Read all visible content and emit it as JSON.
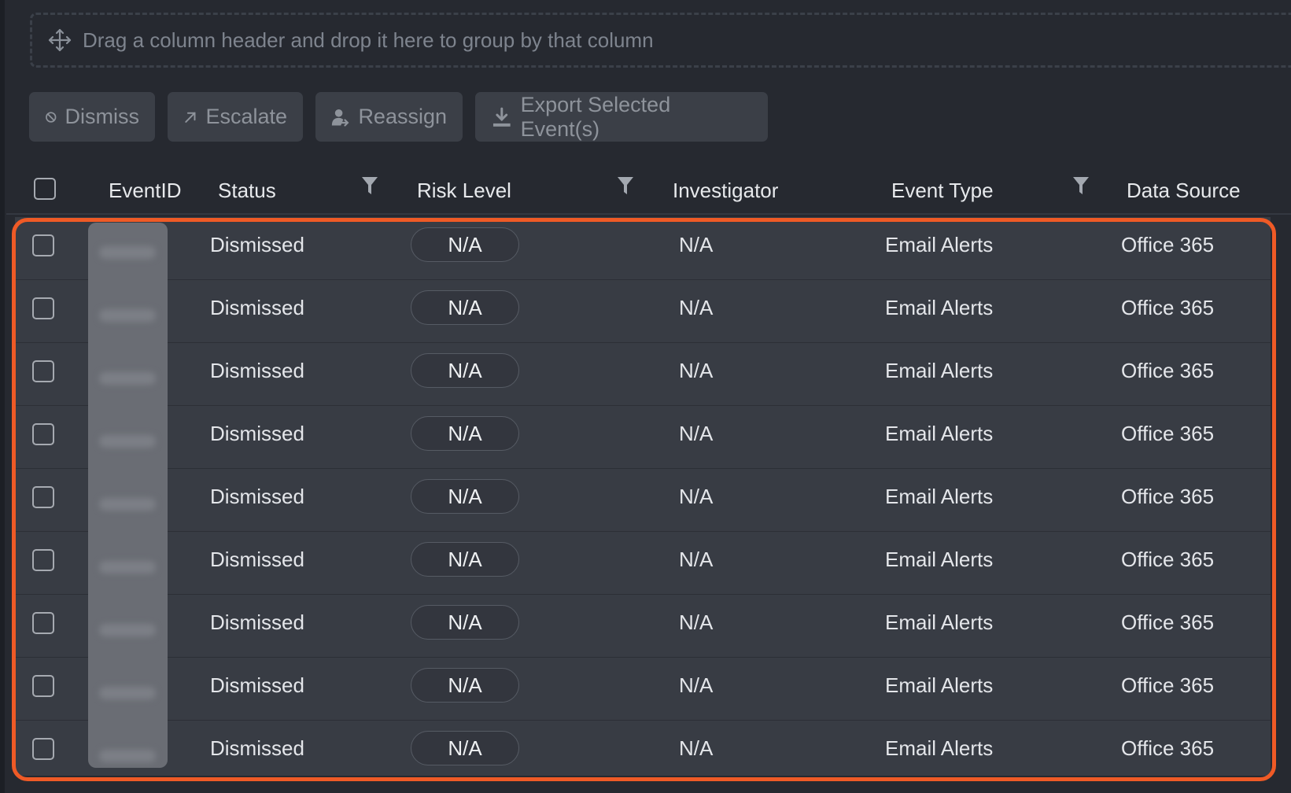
{
  "group_zone": {
    "hint": "Drag a column header and drop it here to group by that column"
  },
  "toolbar": {
    "dismiss_label": "Dismiss",
    "escalate_label": "Escalate",
    "reassign_label": "Reassign",
    "export_label": "Export Selected Event(s)"
  },
  "columns": {
    "event_id": "EventID",
    "status": "Status",
    "risk_level": "Risk Level",
    "investigator": "Investigator",
    "event_type": "Event Type",
    "data_source": "Data Source"
  },
  "rows": [
    {
      "status": "Dismissed",
      "risk": "N/A",
      "investigator": "N/A",
      "event_type": "Email Alerts",
      "data_source": "Office 365"
    },
    {
      "status": "Dismissed",
      "risk": "N/A",
      "investigator": "N/A",
      "event_type": "Email Alerts",
      "data_source": "Office 365"
    },
    {
      "status": "Dismissed",
      "risk": "N/A",
      "investigator": "N/A",
      "event_type": "Email Alerts",
      "data_source": "Office 365"
    },
    {
      "status": "Dismissed",
      "risk": "N/A",
      "investigator": "N/A",
      "event_type": "Email Alerts",
      "data_source": "Office 365"
    },
    {
      "status": "Dismissed",
      "risk": "N/A",
      "investigator": "N/A",
      "event_type": "Email Alerts",
      "data_source": "Office 365"
    },
    {
      "status": "Dismissed",
      "risk": "N/A",
      "investigator": "N/A",
      "event_type": "Email Alerts",
      "data_source": "Office 365"
    },
    {
      "status": "Dismissed",
      "risk": "N/A",
      "investigator": "N/A",
      "event_type": "Email Alerts",
      "data_source": "Office 365"
    },
    {
      "status": "Dismissed",
      "risk": "N/A",
      "investigator": "N/A",
      "event_type": "Email Alerts",
      "data_source": "Office 365"
    },
    {
      "status": "Dismissed",
      "risk": "N/A",
      "investigator": "N/A",
      "event_type": "Email Alerts",
      "data_source": "Office 365"
    }
  ],
  "colors": {
    "background": "#262930",
    "row_background": "#383c44",
    "button_background": "#3b3f47",
    "highlight_border": "#ef5a26"
  },
  "icons": {
    "move": "move-icon",
    "dismiss": "ban-icon",
    "escalate": "arrow-up-right-icon",
    "reassign": "user-arrow-icon",
    "export": "download-icon",
    "filter": "filter-icon"
  }
}
